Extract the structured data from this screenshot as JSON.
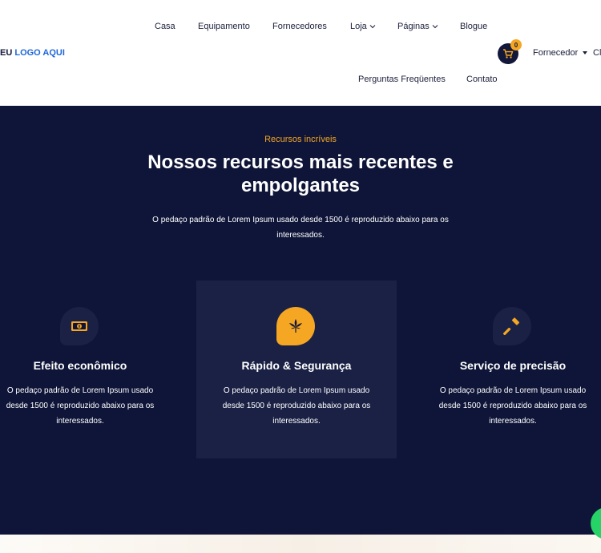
{
  "header": {
    "logo_prefix": "EU",
    "logo_accent": "LOGO AQUI",
    "nav": [
      {
        "label": "Casa"
      },
      {
        "label": "Equipamento"
      },
      {
        "label": "Fornecedores"
      },
      {
        "label": "Loja"
      },
      {
        "label": "Páginas"
      },
      {
        "label": "Blogue"
      },
      {
        "label": "Perguntas Freqüentes"
      },
      {
        "label": "Contato"
      }
    ],
    "cart_count": "0",
    "vendor_label": "Fornecedor",
    "overflow_text": "Cl"
  },
  "features": {
    "eyebrow": "Recursos incríveis",
    "heading": "Nossos recursos mais recentes e empolgantes",
    "subtext": "O pedaço padrão de Lorem Ipsum usado desde 1500 é reproduzido abaixo para os interessados.",
    "cards": [
      {
        "title": "Efeito econômico",
        "desc": "O pedaço padrão de Lorem Ipsum usado desde 1500 é reproduzido abaixo para os interessados.",
        "icon": "money-icon"
      },
      {
        "title": "Rápido & Segurança",
        "desc": "O pedaço padrão de Lorem Ipsum usado desde 1500 é reproduzido abaixo para os interessados.",
        "icon": "leaf-icon"
      },
      {
        "title": "Serviço de precisão",
        "desc": "O pedaço padrão de Lorem Ipsum usado desde 1500 é reproduzido abaixo para os interessados.",
        "icon": "hammer-icon"
      }
    ]
  },
  "colors": {
    "navy": "#0f1538",
    "card_highlight": "#1a2145",
    "accent": "#f5a623",
    "logo_blue": "#1c66d9"
  }
}
